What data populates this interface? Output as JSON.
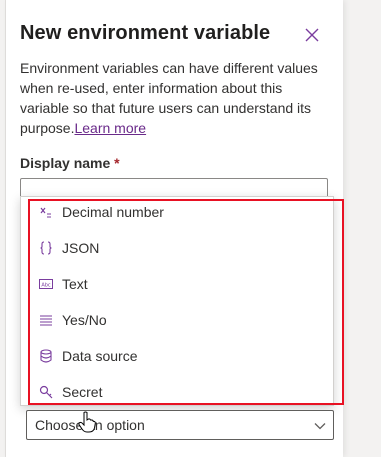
{
  "dialog": {
    "title": "New environment variable",
    "description": "Environment variables can have different values when re-used, enter information about this variable so that future users can understand its purpose.",
    "learn_more": "Learn more"
  },
  "display_name": {
    "label": "Display name",
    "required_mark": "*",
    "value": ""
  },
  "data_type_options": [
    {
      "label": "Decimal number",
      "icon": "decimal-icon"
    },
    {
      "label": "JSON",
      "icon": "json-braces-icon"
    },
    {
      "label": "Text",
      "icon": "text-abc-icon"
    },
    {
      "label": "Yes/No",
      "icon": "list-lines-icon"
    },
    {
      "label": "Data source",
      "icon": "database-icon"
    },
    {
      "label": "Secret",
      "icon": "key-search-icon"
    }
  ],
  "select": {
    "placeholder": "Choose an option"
  },
  "colors": {
    "accent": "#7a3d9e",
    "link": "#6a2a8a",
    "highlight_border": "#e81123",
    "required": "#a4262c"
  }
}
